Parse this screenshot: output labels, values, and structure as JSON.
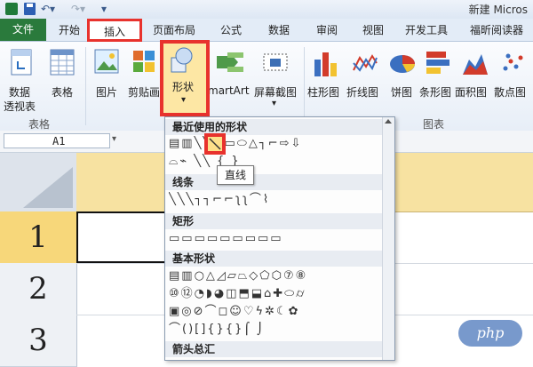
{
  "title_bar": {
    "title": "新建 Micros"
  },
  "tabs": [
    {
      "label": "文件"
    },
    {
      "label": "开始"
    },
    {
      "label": "插入"
    },
    {
      "label": "页面布局"
    },
    {
      "label": "公式"
    },
    {
      "label": "数据"
    },
    {
      "label": "审阅"
    },
    {
      "label": "视图"
    },
    {
      "label": "开发工具"
    },
    {
      "label": "福昕阅读器"
    }
  ],
  "ribbon": {
    "pivot_label_1": "数据",
    "pivot_label_2": "透视表",
    "table_label": "表格",
    "picture_label": "图片",
    "clipart_label": "剪贴画",
    "shapes_label": "形状",
    "smartart_label": "martArt",
    "screenshot_label": "屏幕截图",
    "column_chart": "柱形图",
    "line_chart": "折线图",
    "pie_chart": "饼图",
    "bar_chart": "条形图",
    "area_chart": "面积图",
    "scatter_chart": "散点图",
    "group_tables": "表格",
    "group_charts": "图表",
    "dropdown_arrow": "▾"
  },
  "name_box": {
    "value": "A1"
  },
  "sheet": {
    "rows": [
      "1",
      "2",
      "3"
    ]
  },
  "shapes_panel": {
    "sections": [
      {
        "title": "最近使用的形状"
      },
      {
        "title": "线条"
      },
      {
        "title": "矩形"
      },
      {
        "title": "基本形状"
      },
      {
        "title": "箭头总汇"
      }
    ],
    "recent_row1": "▤▥╲╲▭▭⬭△┐⌐⇨⇩",
    "recent_row2": "⌓⌁ ╲╲ { }",
    "lines_row": "╲╲╲┐┐⌐⌐ʅʅ⌒⌇",
    "rect_row": "▭▭▭▭▭▭▭▭▭",
    "basic_row1": "▤▥○△◿▱⏢◇⬠⬡⑦⑧",
    "basic_row2": "⑩⑫◔◗◕◫⬒⬓⌂✚⬭⌭",
    "basic_row3": "▣◎⊘⌒◻☺♡ϟ✲☾✿",
    "basic_row4": "⌒()[]{}{}⌠ ⌡"
  },
  "tooltip": {
    "text": "直线"
  },
  "watermark": {
    "text": "php"
  }
}
